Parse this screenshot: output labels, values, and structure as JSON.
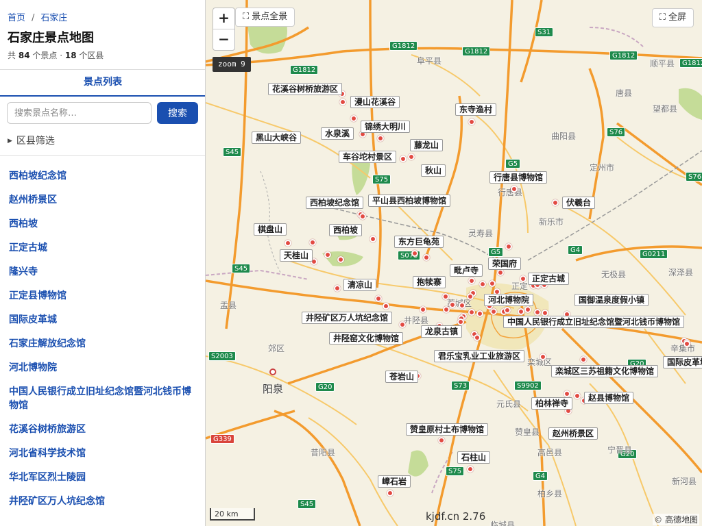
{
  "breadcrumb": {
    "home": "首页",
    "sep": "/",
    "current": "石家庄"
  },
  "page": {
    "title": "石家庄景点地图",
    "stats_prefix": "共",
    "spot_count": "84",
    "spot_unit": "个景点 ·",
    "district_count": "18",
    "district_unit": "个区县"
  },
  "tab": {
    "label": "景点列表"
  },
  "search": {
    "placeholder": "搜索景点名称…",
    "button": "搜索"
  },
  "filter": {
    "label": "区县筛选"
  },
  "spots": [
    "西柏坡纪念馆",
    "赵州桥景区",
    "西柏坡",
    "正定古城",
    "隆兴寺",
    "正定县博物馆",
    "国际皮革城",
    "石家庄解放纪念馆",
    "河北博物院",
    "中国人民银行成立旧址纪念馆暨河北钱币博物馆",
    "花溪谷树桥旅游区",
    "河北省科学技术馆",
    "华北军区烈士陵园",
    "井陉矿区万人坑纪念馆"
  ],
  "map": {
    "zoom_in": "+",
    "zoom_out": "−",
    "overview": "⛶ 景点全景",
    "fullscreen": "⛶ 全屏",
    "zoom_label": "zoom 9",
    "scale": "20 km",
    "version": "kjdf.cn 2.76",
    "attribution": "© 高德地图",
    "labels": [
      "花溪谷树桥旅游区",
      "漫山花溪谷",
      "东寺渔村",
      "水泉溪",
      "锦绣大明川",
      "黑山大峡谷",
      "藤龙山",
      "车谷坨村景区",
      "秋山",
      "行唐县博物馆",
      "西柏坡纪念馆",
      "平山县西柏坡博物馆",
      "伏羲台",
      "棋盘山",
      "西柏坡",
      "东方巨龟苑",
      "天桂山",
      "荣国府",
      "毗卢寺",
      "正定古城",
      "抱犊寨",
      "清凉山",
      "河北博物院",
      "国御温泉度假小镇",
      "井陉矿区万人坑纪念馆",
      "中国人民银行成立旧址纪念馆暨河北钱币博物馆",
      "龙泉古镇",
      "井陉窑文化博物馆",
      "君乐宝乳业工业旅游区",
      "国际皮革城",
      "栾城区三苏祖籍文化博物馆",
      "苍岩山",
      "赵县博物馆",
      "柏林禅寺",
      "赞皇原村土布博物馆",
      "赵州桥景区",
      "石柱山",
      "嶂石岩"
    ],
    "towns": [
      "阜平县",
      "唐县",
      "顺平县",
      "望都县",
      "曲阳县",
      "定州市",
      "灵寿县",
      "新乐市",
      "行唐县",
      "无极县",
      "深泽县",
      "晋州市",
      "藁城区",
      "正定",
      "辛集市",
      "栾城区",
      "元氏县",
      "高邑县",
      "赞皇县",
      "宁晋县",
      "柏乡县",
      "临城县",
      "新河县",
      "昔阳县",
      "盂县",
      "井陉县",
      "郊区",
      "阳泉"
    ],
    "roads": [
      "G1812",
      "G1812",
      "G1812",
      "G1812",
      "G1812",
      "S31",
      "S45",
      "S75",
      "G5",
      "S76",
      "S76",
      "G4",
      "S073",
      "G5",
      "S45",
      "G0211",
      "G20",
      "S2003",
      "G20",
      "S73",
      "S9902",
      "G339",
      "S45",
      "G4",
      "G20",
      "S75"
    ],
    "colors": {
      "road_major": "#f39b2e",
      "road_minor": "#f7c96a",
      "land": "#f5f1e3",
      "forest": "#c5dc98",
      "marker": "#e24a42",
      "link": "#1a4fb0"
    }
  }
}
